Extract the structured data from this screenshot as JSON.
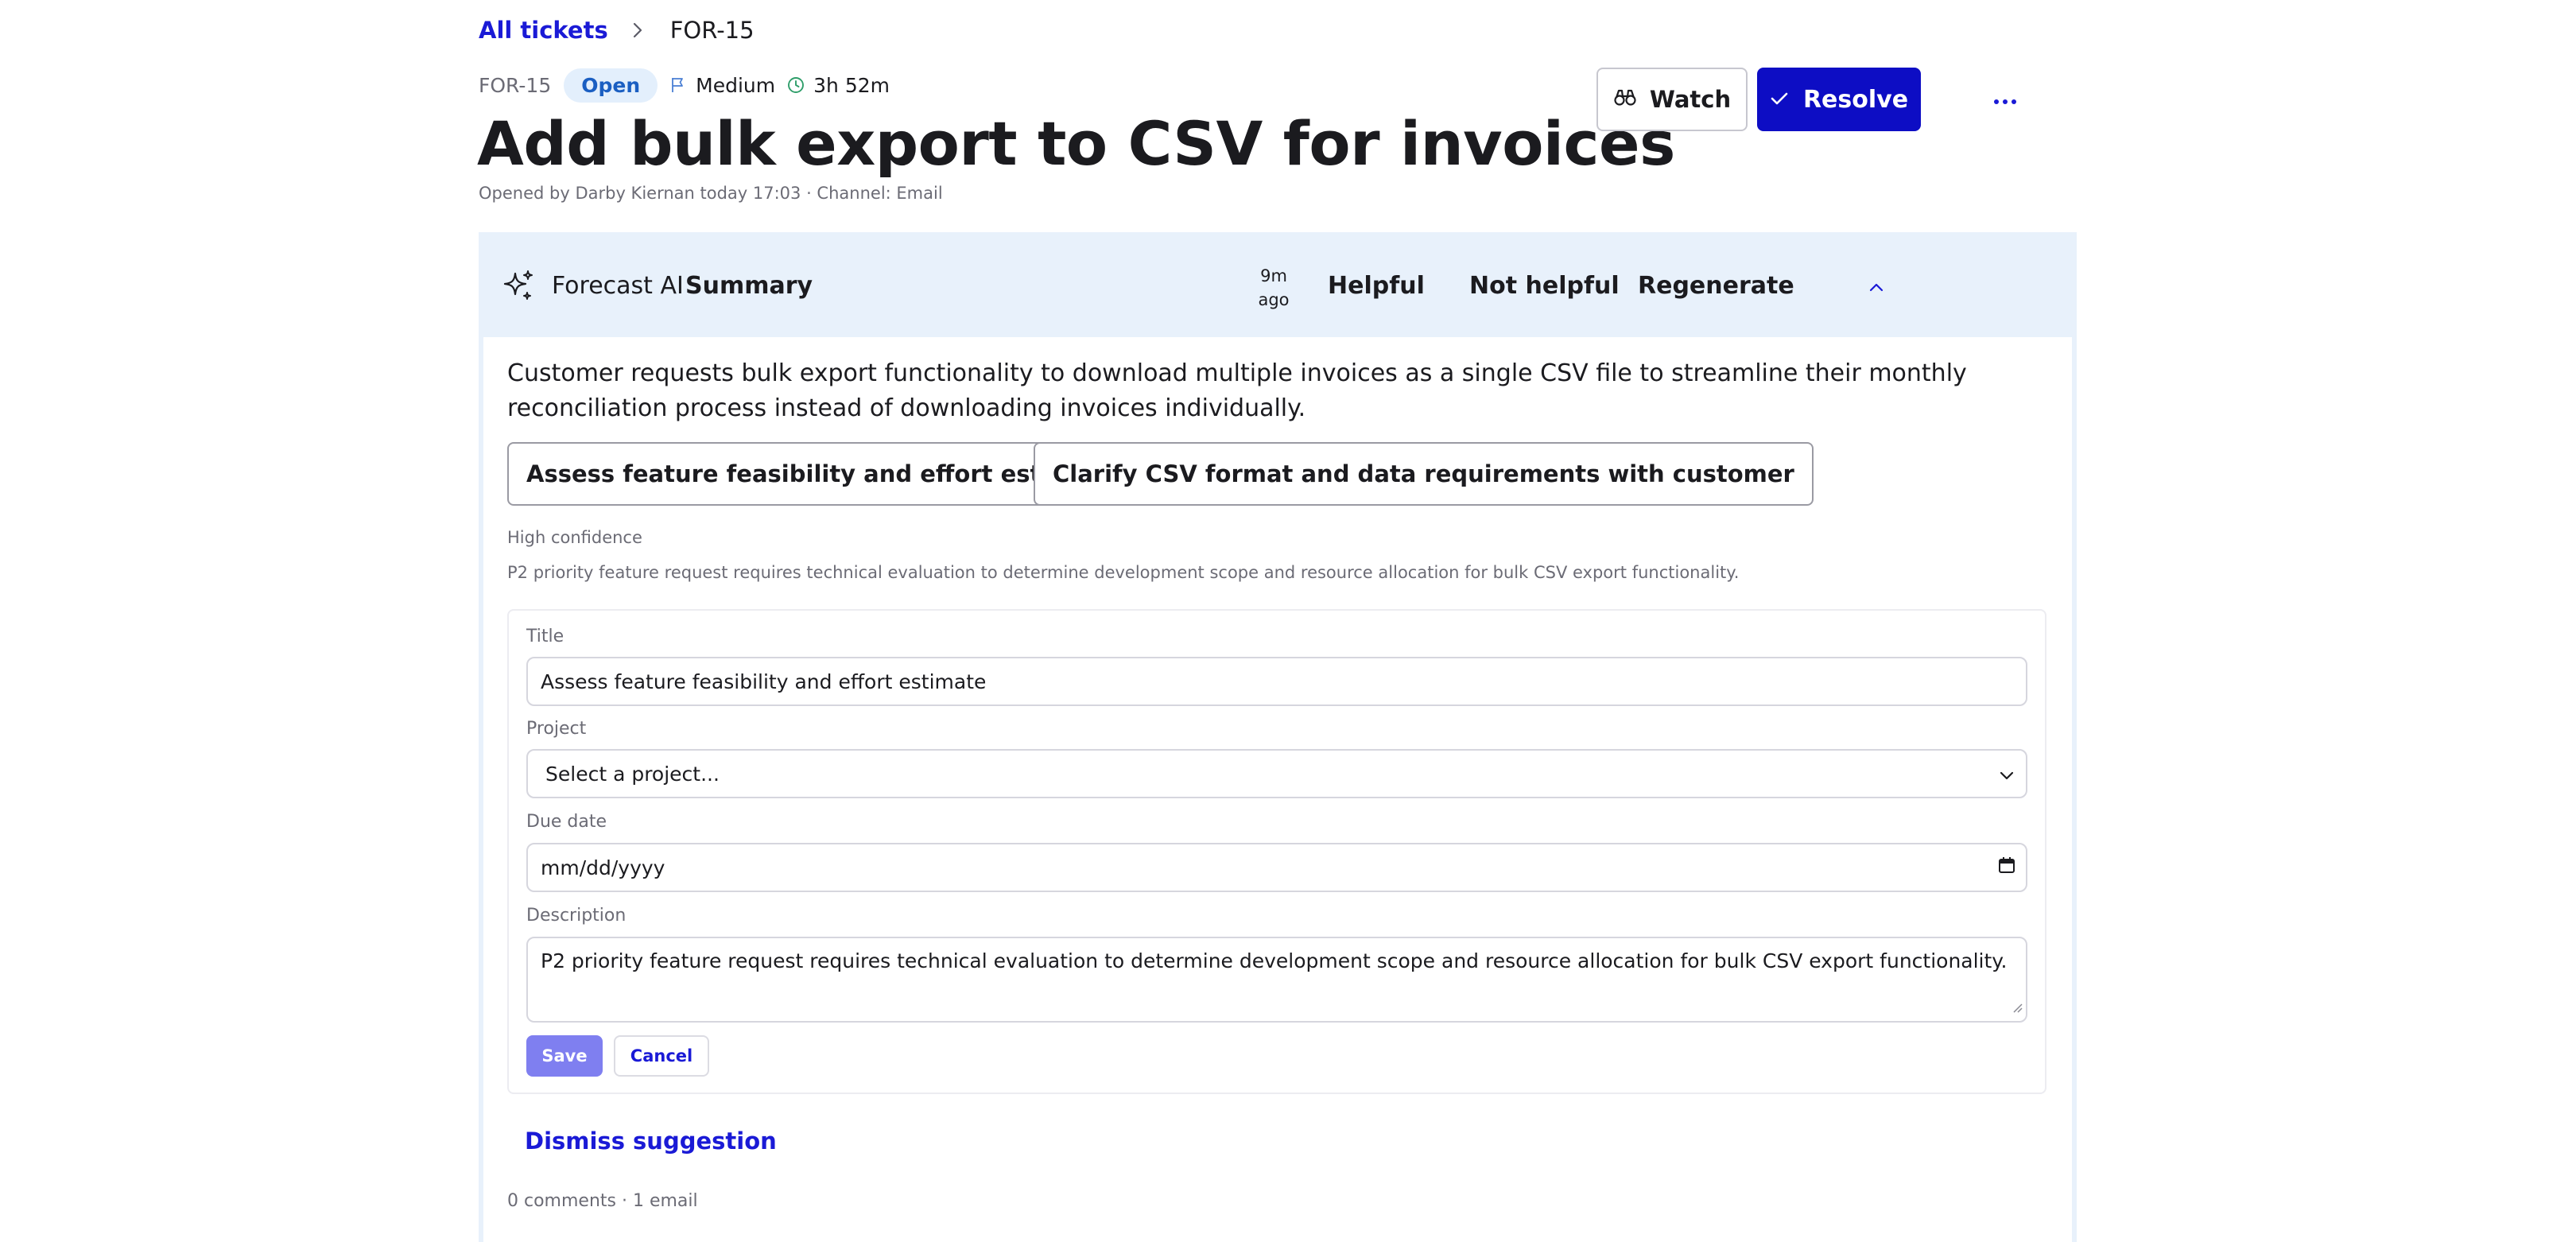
{
  "breadcrumb": {
    "parent": "All tickets",
    "current": "FOR-15"
  },
  "ticket": {
    "id": "FOR-15",
    "status": "Open",
    "priority": "Medium",
    "time": "3h 52m",
    "title": "Add bulk export to CSV for invoices",
    "opened": "Opened by Darby Kiernan today 17:03 · Channel: Email"
  },
  "actions": {
    "watch": "Watch",
    "resolve": "Resolve",
    "more": "…"
  },
  "ai": {
    "name": "Forecast AI",
    "kind": "Summary",
    "ago_line1": "9m",
    "ago_line2": "ago",
    "helpful": "Helpful",
    "not_helpful": "Not helpful",
    "regenerate": "Regenerate",
    "summary": "Customer requests bulk export functionality to download multiple invoices as a single CSV file to streamline their monthly reconciliation process instead of downloading invoices individually.",
    "suggestions": [
      "Assess feature feasibility and effort estimate",
      "Clarify CSV format and data requirements with customer"
    ],
    "confidence": "High confidence",
    "rationale": "P2 priority feature request requires technical evaluation to determine development scope and resource allocation for bulk CSV export functionality."
  },
  "form": {
    "title_label": "Title",
    "title_value": "Assess feature feasibility and effort estimate",
    "project_label": "Project",
    "project_value": "Select a project...",
    "due_label": "Due date",
    "due_value": "mm/dd/yyyy",
    "desc_label": "Description",
    "desc_value": "P2 priority feature request requires technical evaluation to determine development scope and resource allocation for bulk CSV export functionality.",
    "save": "Save",
    "cancel": "Cancel"
  },
  "dismiss": "Dismiss suggestion",
  "footer": "0 comments · 1 email",
  "colors": {
    "accent": "#0d0dc4",
    "link": "#1a1ad6",
    "panel_bg": "#e8f1fb",
    "badge_bg": "#e3effc",
    "save_disabled": "#7f7ff0"
  }
}
